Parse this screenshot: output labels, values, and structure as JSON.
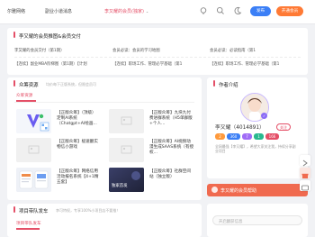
{
  "header": {
    "nav_items": [
      "尔雅网络",
      "副业小道消息",
      "李又耀的会员(独家)"
    ],
    "vip_label": "发布",
    "member_label": "开通会员"
  },
  "vip_links": {
    "title": "李又耀的会员推图&会员交付",
    "cells": [
      [
        "李又耀的会员交付（第1期）",
        "会员必读：会员的学习地图",
        "会员必读：必读指南（第1"
      ],
      [
        "【连续】副业MBA阶梯图（第1期）【计划",
        "【连续】职场工作、管理必学基础（第1",
        "【连续】职场工作、管理必学基础（第1"
      ]
    ]
  },
  "resources": {
    "title": "众筹资源",
    "subtitle": "均价每下正版系统，但限会员可",
    "tab": "众筹资源",
    "items": [
      {
        "text": "【正版众筹】（顶级）定制AI系统（Chatgpt+AI绘画..."
      },
      {
        "text": "【正版众筹】九块九付费进群系统（H5单群版+个人..."
      },
      {
        "text": "【正版众筹】极速翻实物信小游戏"
      },
      {
        "text": "【正版众筹】AI视频动漫生成SAAS系统（有授权..."
      },
      {
        "text": "【正版众筹】网络信用活动报名系统【4+1精五套】"
      },
      {
        "text": "【正版众筹】社群空间站（独立版）"
      }
    ],
    "thumb_caption": "独家首发"
  },
  "author": {
    "title": "作者介绍",
    "name": "李又耀（4014891）",
    "follow_label": "关注",
    "stats": [
      "2",
      "360",
      "7",
      "1",
      "166"
    ],
    "bio": "全网最强【李又耀】，希望大家关注我，持续分享副业项目",
    "banner": "李又耀的会员帮助"
  },
  "column": {
    "title": "项目带队发车",
    "subtitle": "李可特权，专享100%小项目店不要推！",
    "tab": "项目带队发车"
  },
  "search": {
    "placeholder": "开启翻获信息"
  },
  "colors": {
    "accent": "#e44f67",
    "primary_blue": "#3b7ff6",
    "orange": "#ff7a35"
  }
}
